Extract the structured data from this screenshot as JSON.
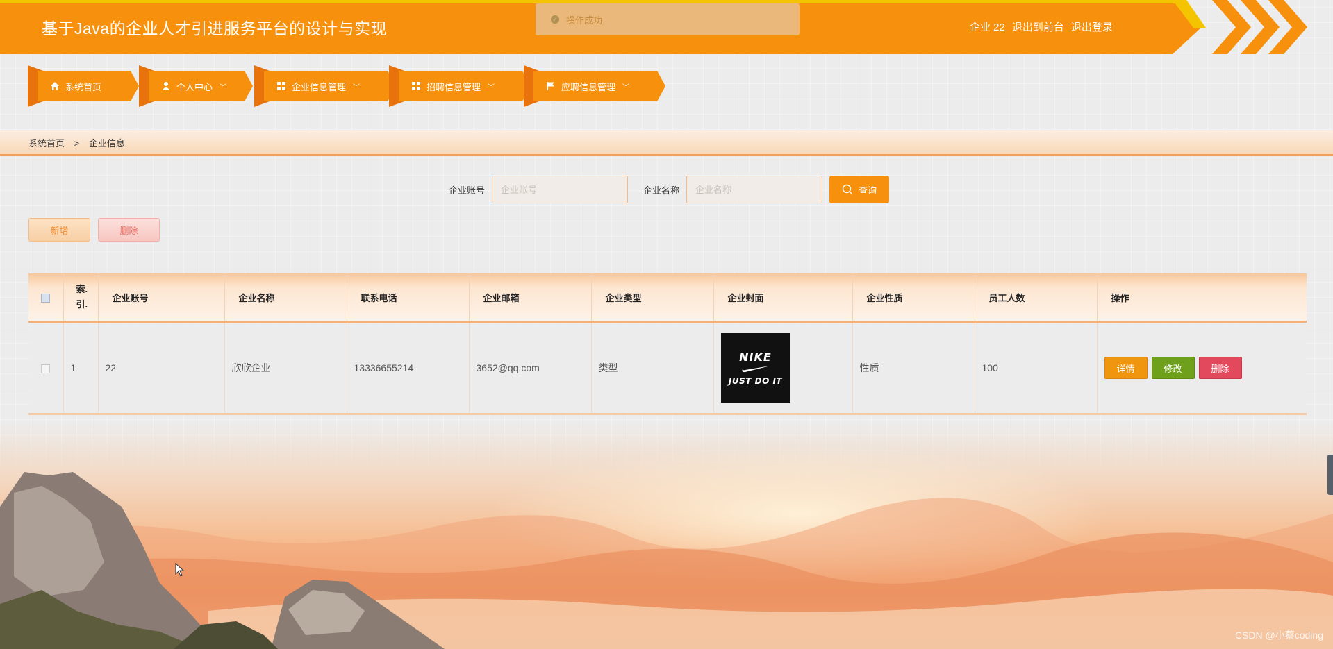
{
  "header": {
    "title": "基于Java的企业人才引进服务平台的设计与实现",
    "user": "企业 22",
    "back_to_front": "退出到前台",
    "logout": "退出登录",
    "accent_color": "#f7900c"
  },
  "toast": {
    "icon": "check-circle-icon",
    "message": "操作成功"
  },
  "nav": {
    "items": [
      {
        "label": "系统首页",
        "icon": "home-icon",
        "dropdown": false
      },
      {
        "label": "个人中心",
        "icon": "user-icon",
        "dropdown": true
      },
      {
        "label": "企业信息管理",
        "icon": "grid-icon",
        "dropdown": true
      },
      {
        "label": "招聘信息管理",
        "icon": "grid-icon",
        "dropdown": true
      },
      {
        "label": "应聘信息管理",
        "icon": "flag-icon",
        "dropdown": true
      }
    ]
  },
  "breadcrumb": {
    "home": "系统首页",
    "separator": ">",
    "current": "企业信息"
  },
  "search": {
    "account_label": "企业账号",
    "account_placeholder": "企业账号",
    "name_label": "企业名称",
    "name_placeholder": "企业名称",
    "query_label": "查询"
  },
  "actions": {
    "add_label": "新增",
    "delete_label": "删除"
  },
  "table": {
    "headers": [
      "索引",
      "企业账号",
      "企业名称",
      "联系电话",
      "企业邮箱",
      "企业类型",
      "企业封面",
      "企业性质",
      "员工人数",
      "操作"
    ],
    "index_header_lines": [
      "索.",
      "引."
    ],
    "rows": [
      {
        "index": "1",
        "account": "22",
        "name": "欣欣企业",
        "phone": "13336655214",
        "email": "3652@qq.com",
        "type": "类型",
        "cover_brand": "NIKE",
        "cover_slogan": "JUST DO IT",
        "nature": "性质",
        "employees": "100",
        "op_detail": "详情",
        "op_edit": "修改",
        "op_delete": "删除"
      }
    ]
  },
  "watermark": "CSDN @小蔡coding"
}
